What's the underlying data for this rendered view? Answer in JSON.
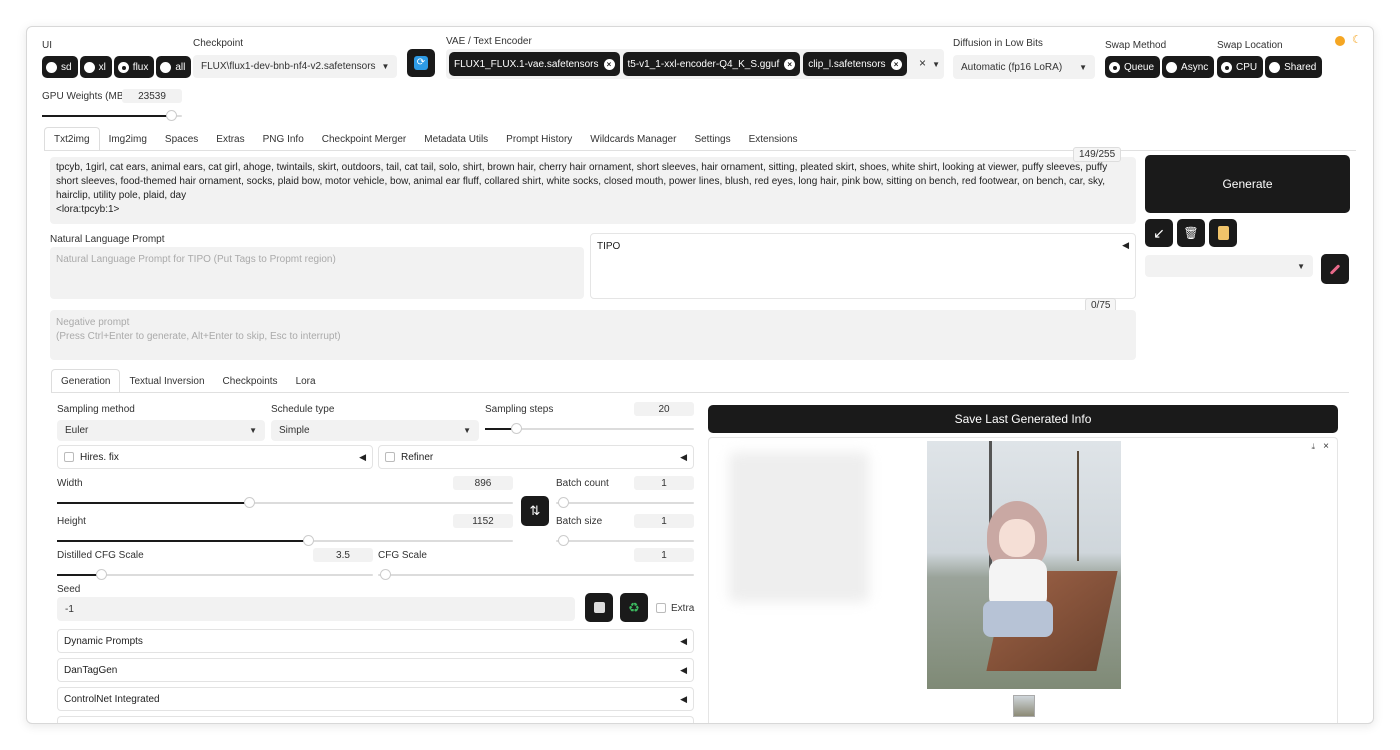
{
  "top": {
    "ui_label": "UI",
    "ui_options": [
      "sd",
      "xl",
      "flux",
      "all"
    ],
    "ui_selected": "flux",
    "checkpoint_label": "Checkpoint",
    "checkpoint_value": "FLUX\\flux1-dev-bnb-nf4-v2.safetensors",
    "vae_label": "VAE / Text Encoder",
    "vae_chips": [
      "FLUX1_FLUX.1-vae.safetensors",
      "t5-v1_1-xxl-encoder-Q4_K_S.gguf",
      "clip_l.safetensors"
    ],
    "diffusion_label": "Diffusion in Low Bits",
    "diffusion_value": "Automatic (fp16 LoRA)",
    "swap_method_label": "Swap Method",
    "swap_method_options": [
      "Queue",
      "Async"
    ],
    "swap_method_selected": "Queue",
    "swap_location_label": "Swap Location",
    "swap_location_options": [
      "CPU",
      "Shared"
    ],
    "swap_location_selected": "CPU",
    "gpu_label": "GPU Weights (MB)",
    "gpu_value": "23539",
    "gpu_fraction": 0.92
  },
  "tabs": [
    "Txt2img",
    "Img2img",
    "Spaces",
    "Extras",
    "PNG Info",
    "Checkpoint Merger",
    "Metadata Utils",
    "Prompt History",
    "Wildcards Manager",
    "Settings",
    "Extensions"
  ],
  "prompt": {
    "text": "tpcyb, 1girl, cat ears, animal ears, cat girl, ahoge, twintails, skirt, outdoors, tail, cat tail, solo, shirt, brown hair, cherry hair ornament, short sleeves, hair ornament, sitting, pleated skirt, shoes, white shirt, looking at viewer, puffy sleeves, puffy short sleeves, food-themed hair ornament, socks, plaid bow, motor vehicle, bow, animal ear fluff, collared shirt, white socks, closed mouth, power lines, blush, red eyes, long hair, pink bow, sitting on bench, red footwear, on bench, car, sky, hairclip, utility pole, plaid, day",
    "lora": "<lora:tpcyb:1>",
    "counter": "149/255",
    "nl_label": "Natural Language Prompt",
    "nl_placeholder": "Natural Language Prompt for TIPO (Put Tags to Propmt region)",
    "tipo_label": "TIPO",
    "neg_counter": "0/75",
    "neg_placeholder_1": "Negative prompt",
    "neg_placeholder_2": "(Press Ctrl+Enter to generate, Alt+Enter to skip, Esc to interrupt)"
  },
  "generate_label": "Generate",
  "subtabs": [
    "Generation",
    "Textual Inversion",
    "Checkpoints",
    "Lora"
  ],
  "params": {
    "sampling_method_label": "Sampling method",
    "sampling_method": "Euler",
    "schedule_type_label": "Schedule type",
    "schedule_type": "Simple",
    "sampling_steps_label": "Sampling steps",
    "sampling_steps": "20",
    "sampling_steps_fraction": 0.15,
    "hires_label": "Hires. fix",
    "refiner_label": "Refiner",
    "width_label": "Width",
    "width": "896",
    "width_fraction": 0.42,
    "height_label": "Height",
    "height": "1152",
    "height_fraction": 0.55,
    "batch_count_label": "Batch count",
    "batch_count": "1",
    "batch_size_label": "Batch size",
    "batch_size": "1",
    "distilled_cfg_label": "Distilled CFG Scale",
    "distilled_cfg": "3.5",
    "distilled_cfg_fraction": 0.14,
    "cfg_label": "CFG Scale",
    "cfg": "1",
    "seed_label": "Seed",
    "seed": "-1",
    "extra_label": "Extra",
    "accordions": [
      "Dynamic Prompts",
      "DanTagGen",
      "ControlNet Integrated"
    ]
  },
  "save_info_label": "Save Last Generated Info",
  "colors": {
    "dark": "#1a1a1a",
    "accent_sun": "#f5a623"
  },
  "icons": [
    "swap-arrow-icon",
    "refresh-icon",
    "trash-icon",
    "clipboard-icon",
    "paint-brush-icon",
    "dice-icon",
    "recycle-icon",
    "download-icon",
    "close-icon",
    "sun-icon",
    "moon-icon"
  ]
}
